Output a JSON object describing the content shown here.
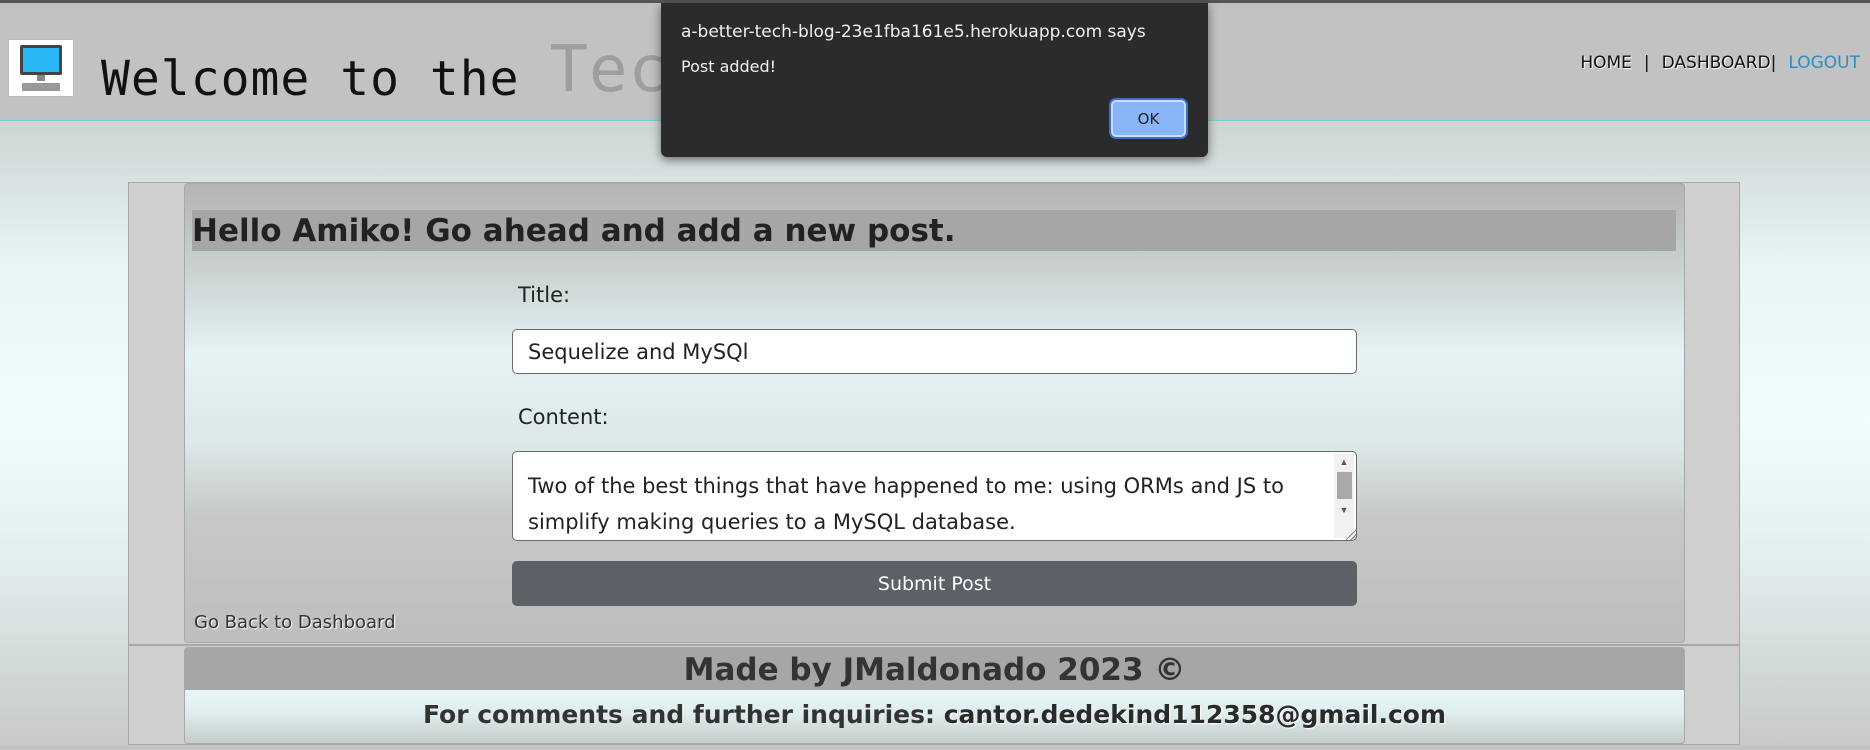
{
  "header": {
    "title_main": "Welcome to the ",
    "title_faded": "Tech",
    "nav": {
      "home": "HOME",
      "separator": "|",
      "dashboard": "DASHBOARD",
      "logout": "LOGOUT"
    }
  },
  "form": {
    "heading": "Hello Amiko! Go ahead and add a new post.",
    "title_label": "Title:",
    "title_value": "Sequelize and MySQl",
    "content_label": "Content:",
    "content_value": "Two of the best things that have happened to me: using ORMs and JS to simplify making queries to a MySQL database.",
    "submit_label": "Submit Post",
    "back_link": "Go Back to Dashboard"
  },
  "footer": {
    "made_by": "Made by JMaldonado 2023 ©",
    "contact_prefix": "For comments and further inquiries: ",
    "email": "cantor.dedekind112358@gmail.com"
  },
  "dialog": {
    "origin": "a-better-tech-blog-23e1fba161e5.herokuapp.com says",
    "message": "Post added!",
    "ok_label": "OK"
  },
  "icons": {
    "logo": "computer-monitor-icon",
    "scroll_up": "scroll-up-arrow-icon",
    "scroll_down": "scroll-down-arrow-icon",
    "resize": "resize-grip-icon"
  },
  "colors": {
    "header_bg": "#c2c2c2",
    "logout_link": "#2a8fc8",
    "submit_button": "#5c6167",
    "dialog_bg": "#2b2b2e",
    "ok_button": "#8ab4f8"
  }
}
